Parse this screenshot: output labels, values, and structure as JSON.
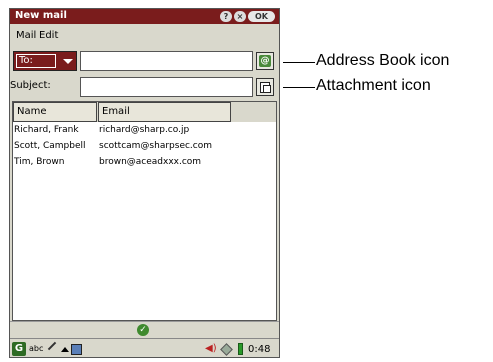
{
  "window": {
    "title": "New mail",
    "help_label": "?",
    "close_label": "×",
    "ok_label": "OK"
  },
  "menu": {
    "items": [
      {
        "label": "Mail"
      },
      {
        "label": "Edit"
      }
    ]
  },
  "to_row": {
    "dropdown_value": "To:",
    "input_value": ""
  },
  "subject_row": {
    "label": "Subject:",
    "input_value": ""
  },
  "list": {
    "columns": [
      "Name",
      "Email"
    ],
    "rows": [
      {
        "name": "Richard, Frank",
        "email": "richard@sharp.co.jp"
      },
      {
        "name": "Scott, Campbell",
        "email": "scottcam@sharpsec.com"
      },
      {
        "name": "Tim, Brown",
        "email": "brown@aceadxxx.com"
      }
    ]
  },
  "taskbar": {
    "input_method": "abc",
    "time": "0:48"
  },
  "callouts": {
    "address_book": "Address Book icon",
    "attachment": "Attachment icon"
  }
}
